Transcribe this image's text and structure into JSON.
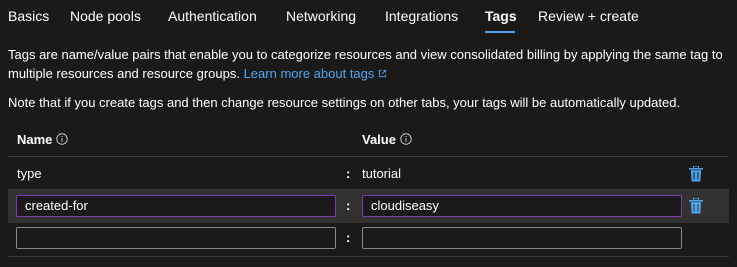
{
  "tabs": [
    {
      "label": "Basics"
    },
    {
      "label": "Node pools"
    },
    {
      "label": "Authentication"
    },
    {
      "label": "Networking"
    },
    {
      "label": "Integrations"
    },
    {
      "label": "Tags"
    },
    {
      "label": "Review + create"
    }
  ],
  "active_tab": "Tags",
  "description": {
    "text": "Tags are name/value pairs that enable you to categorize resources and view consolidated billing by applying the same tag to multiple resources and resource groups.",
    "link": "Learn more about tags"
  },
  "note": "Note that if you create tags and then change resource settings on other tabs, your tags will be automatically updated.",
  "table": {
    "headers": {
      "name": "Name",
      "value": "Value"
    },
    "separator": ":",
    "rows": [
      {
        "name": "type",
        "value": "tutorial",
        "editable": false
      },
      {
        "name": "created-for",
        "value": "cloudiseasy",
        "editable": true
      },
      {
        "name": "",
        "value": "",
        "editable": true
      }
    ]
  },
  "colors": {
    "background": "#1b1a19",
    "link": "#4ea6f2",
    "trash": "#4ea6f2",
    "input_focus_border": "#7a3db0",
    "row_highlight": "#323130"
  }
}
